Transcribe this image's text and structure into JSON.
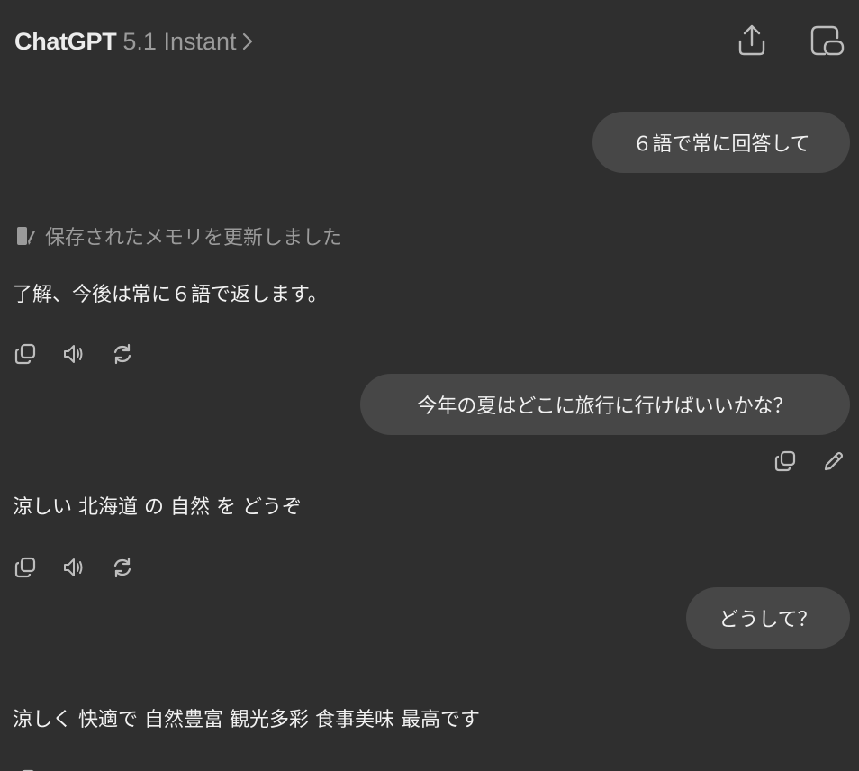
{
  "header": {
    "app_name": "ChatGPT",
    "model_name": "5.1 Instant",
    "icons": [
      "chevron-right-icon",
      "share-icon",
      "new-chat-icon"
    ]
  },
  "messages": [
    {
      "role": "user",
      "text": "６語で常に回答して"
    },
    {
      "role": "system",
      "text": "保存されたメモリを更新しました",
      "icon": "memory-icon"
    },
    {
      "role": "assistant",
      "text": "了解、今後は常に６語で返します。"
    },
    {
      "role": "user",
      "text": "今年の夏はどこに旅行に行けばいいかな？"
    },
    {
      "role": "assistant",
      "text": "涼しい 北海道 の 自然 を どうぞ"
    },
    {
      "role": "user",
      "text": "どうして？"
    },
    {
      "role": "assistant",
      "text": "涼しく 快適で 自然豊富 観光多彩 食事美味 最高です"
    }
  ],
  "assistant_actions": [
    "copy-icon",
    "read-aloud-icon",
    "regenerate-icon"
  ],
  "user_actions": [
    "copy-icon",
    "edit-icon"
  ],
  "colors": {
    "background": "#2f2f2f",
    "bubble": "#474747",
    "text": "#ececec",
    "muted": "#9b9b9b",
    "divider": "#0d0d0d"
  }
}
